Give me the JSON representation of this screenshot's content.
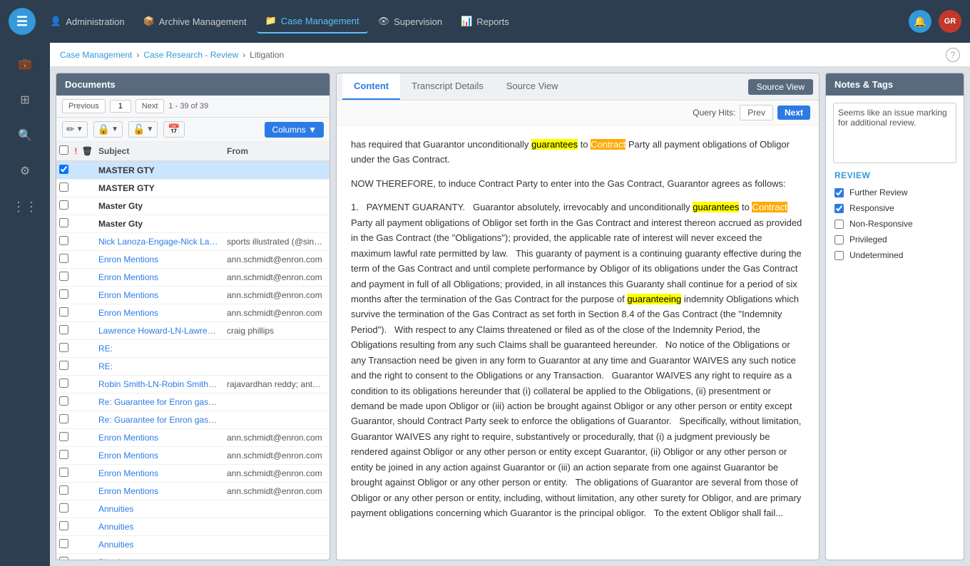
{
  "topnav": {
    "logo": "☰",
    "items": [
      {
        "id": "administration",
        "label": "Administration",
        "icon": "👤",
        "active": false
      },
      {
        "id": "archive",
        "label": "Archive Management",
        "icon": "📦",
        "active": false
      },
      {
        "id": "case",
        "label": "Case Management",
        "icon": "📁",
        "active": true
      },
      {
        "id": "supervision",
        "label": "Supervision",
        "icon": "👁",
        "active": false
      },
      {
        "id": "reports",
        "label": "Reports",
        "icon": "📊",
        "active": false
      }
    ],
    "bell_icon": "🔔",
    "avatar_initials": "GR",
    "help_icon": "?"
  },
  "breadcrumb": {
    "items": [
      {
        "label": "Case Management",
        "link": true
      },
      {
        "label": "Case Research - Review",
        "link": true
      },
      {
        "label": "Litigation",
        "link": false
      }
    ],
    "separator": "›"
  },
  "sidebar": {
    "icons": [
      {
        "id": "briefcase",
        "symbol": "💼"
      },
      {
        "id": "grid",
        "symbol": "⊞"
      },
      {
        "id": "search",
        "symbol": "🔍"
      },
      {
        "id": "settings",
        "symbol": "⚙"
      },
      {
        "id": "dots",
        "symbol": "⠿"
      }
    ]
  },
  "documents_panel": {
    "title": "Documents",
    "prev_label": "Previous",
    "next_label": "Next",
    "page_input": "1",
    "page_info": "1 - 39 of 39",
    "columns_label": "Columns ▼",
    "col_subject": "Subject",
    "col_from": "From",
    "rows": [
      {
        "selected": true,
        "flag": false,
        "del": false,
        "subject": "MASTER GTY",
        "from": "",
        "subject_blue": false
      },
      {
        "selected": false,
        "flag": false,
        "del": false,
        "subject": "MASTER GTY",
        "from": "",
        "subject_blue": false
      },
      {
        "selected": false,
        "flag": false,
        "del": false,
        "subject": "Master Gty",
        "from": "",
        "subject_blue": false
      },
      {
        "selected": false,
        "flag": false,
        "del": false,
        "subject": "Master Gty",
        "from": "",
        "subject_blue": false
      },
      {
        "selected": false,
        "flag": false,
        "del": false,
        "subject": "Nick Lanoza-Engage-Nick Lano...",
        "from": "sports illustrated (@sinow); es...",
        "subject_blue": true
      },
      {
        "selected": false,
        "flag": false,
        "del": false,
        "subject": "Enron Mentions",
        "from": "ann.schmidt@enron.com",
        "subject_blue": true
      },
      {
        "selected": false,
        "flag": false,
        "del": false,
        "subject": "Enron Mentions",
        "from": "ann.schmidt@enron.com",
        "subject_blue": true
      },
      {
        "selected": false,
        "flag": false,
        "del": false,
        "subject": "Enron Mentions",
        "from": "ann.schmidt@enron.com",
        "subject_blue": true
      },
      {
        "selected": false,
        "flag": false,
        "del": false,
        "subject": "Enron Mentions",
        "from": "ann.schmidt@enron.com",
        "subject_blue": true
      },
      {
        "selected": false,
        "flag": false,
        "del": false,
        "subject": "Lawrence Howard-LN-Lawrenc...",
        "from": "craig phillips",
        "subject_blue": true
      },
      {
        "selected": false,
        "flag": false,
        "del": false,
        "subject": "RE:",
        "from": "",
        "subject_blue": true
      },
      {
        "selected": false,
        "flag": false,
        "del": false,
        "subject": "RE:",
        "from": "",
        "subject_blue": true
      },
      {
        "selected": false,
        "flag": false,
        "del": false,
        "subject": "Robin Smith-LN-Robin Smith |...",
        "from": "rajavardhan reddy; anthony ch...",
        "subject_blue": true
      },
      {
        "selected": false,
        "flag": false,
        "del": false,
        "subject": "Re: Guarantee for Enron gas co...",
        "from": "",
        "subject_blue": true
      },
      {
        "selected": false,
        "flag": false,
        "del": false,
        "subject": "Re: Guarantee for Enron gas co...",
        "from": "",
        "subject_blue": true
      },
      {
        "selected": false,
        "flag": false,
        "del": false,
        "subject": "Enron Mentions",
        "from": "ann.schmidt@enron.com",
        "subject_blue": true
      },
      {
        "selected": false,
        "flag": false,
        "del": false,
        "subject": "Enron Mentions",
        "from": "ann.schmidt@enron.com",
        "subject_blue": true
      },
      {
        "selected": false,
        "flag": false,
        "del": false,
        "subject": "Enron Mentions",
        "from": "ann.schmidt@enron.com",
        "subject_blue": true
      },
      {
        "selected": false,
        "flag": false,
        "del": false,
        "subject": "Enron Mentions",
        "from": "ann.schmidt@enron.com",
        "subject_blue": true
      },
      {
        "selected": false,
        "flag": false,
        "del": false,
        "subject": "Annuities",
        "from": "",
        "subject_blue": true
      },
      {
        "selected": false,
        "flag": false,
        "del": false,
        "subject": "Annuities",
        "from": "",
        "subject_blue": true
      },
      {
        "selected": false,
        "flag": false,
        "del": false,
        "subject": "Annuities",
        "from": "",
        "subject_blue": true
      },
      {
        "selected": false,
        "flag": false,
        "del": false,
        "subject": "Ring language",
        "from": "",
        "subject_blue": true
      }
    ]
  },
  "content_panel": {
    "tabs": [
      {
        "id": "content",
        "label": "Content",
        "active": true
      },
      {
        "id": "transcript",
        "label": "Transcript Details",
        "active": false
      },
      {
        "id": "source",
        "label": "Source View",
        "active": false
      }
    ],
    "source_view_btn": "Source View",
    "query_hits_label": "Query Hits:",
    "prev_btn": "Prev",
    "next_btn": "Next",
    "content_paragraphs": [
      "has required that Guarantor unconditionally guarantees to Contract Party all payment obligations of Obligor under the Gas Contract.",
      "NOW THEREFORE, to induce Contract Party to enter into the Gas Contract, Guarantor agrees as follows:",
      "1.  PAYMENT GUARANTY.  Guarantor absolutely, irrevocably and unconditionally guarantees to Contract Party all payment obligations of Obligor set forth in the Gas Contract and interest thereon accrued as provided in the Gas Contract (the \"Obligations\"); provided, the applicable rate of interest will never exceed the maximum lawful rate permitted by law.  This guaranty of payment is a continuing guaranty effective during the term of the Gas Contract and until complete performance by Obligor of its obligations under the Gas Contract and payment in full of all Obligations; provided, in all instances this Guaranty shall continue for a period of six months after the termination of the Gas Contract for the purpose of guaranteeing indemnity Obligations which survive the termination of the Gas Contract as set forth in Section 8.4 of the Gas Contract (the \"Indemnity Period\").  With respect to any Claims threatened or filed as of the close of the Indemnity Period, the Obligations resulting from any such Claims shall be guaranteed hereunder.  No notice of the Obligations or any Transaction need be given in any form to Guarantor at any time and Guarantor WAIVES any such notice and the right to consent to the Obligations or any Transaction.  Guarantor WAIVES any right to require as a condition to its obligations hereunder that (i) collateral be applied to the Obligations, (ii) presentment or demand be made upon Obligor or (iii) action be brought against Obligor or any other person or entity except Guarantor, should Contract Party seek to enforce the obligations of Guarantor.  Specifically, without limitation, Guarantor WAIVES any right to require, substantively or procedurally, that (i) a judgment previously be rendered against Obligor or any other person or entity except Guarantor, (ii) Obligor or any other person or entity be joined in any action against Guarantor or (iii) an action separate from one against Guarantor be brought against Obligor or any other person or entity.  The obligations of Guarantor are several from those of Obligor or any other person or entity, including, without limitation, any other surety for Obligor, and are primary payment obligations concerning which Guarantor is the principal obligor.  To the extent Obligor shall fail..."
    ],
    "highlighted_words": [
      "guarantees",
      "Contract",
      "guarantees",
      "Contract",
      "guaranteeing"
    ]
  },
  "notes_panel": {
    "title": "Notes & Tags",
    "textarea_value": "Seems like an issue marking for additional review.",
    "review_title": "REVIEW",
    "review_items": [
      {
        "id": "further_review",
        "label": "Further Review",
        "checked": true
      },
      {
        "id": "responsive",
        "label": "Responsive",
        "checked": true
      },
      {
        "id": "non_responsive",
        "label": "Non-Responsive",
        "checked": false
      },
      {
        "id": "privileged",
        "label": "Privileged",
        "checked": false
      },
      {
        "id": "undetermined",
        "label": "Undetermined",
        "checked": false
      }
    ]
  }
}
